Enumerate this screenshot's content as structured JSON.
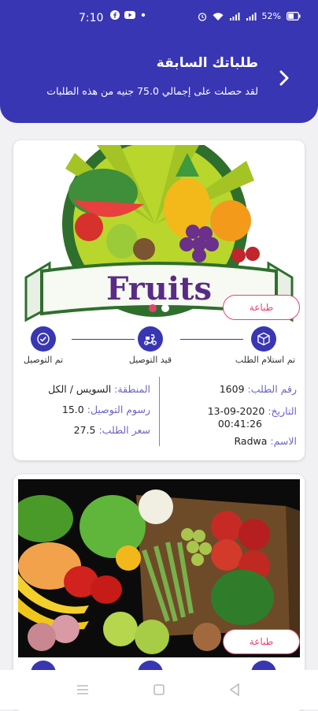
{
  "status_bar": {
    "time": "7:10",
    "battery": "52%",
    "icons_left": [
      "facebook-icon",
      "youtube-icon",
      "dot-icon"
    ],
    "icons_right": [
      "alarm-icon",
      "wifi-icon",
      "signal-icon",
      "battery-icon"
    ]
  },
  "header": {
    "title": "طلباتك السابقة",
    "subtitle": "لقد حصلت على إجمالي 75.0 جنيه من هذه الطلبات",
    "back_icon": "chevron-right-icon"
  },
  "orders": [
    {
      "image_text": "Fruits",
      "print_label": "طباعة",
      "steps": [
        {
          "label": "تم استلام الطلب",
          "icon": "box-icon"
        },
        {
          "label": "قيد التوصيل",
          "icon": "delivery-scooter-icon"
        },
        {
          "label": "تم التوصيل",
          "icon": "check-icon"
        }
      ],
      "order_number_label": "رقم الطلب:",
      "order_number": "1609",
      "date_label": "التاريخ:",
      "date": "2020-09-13",
      "time": "00:41:26",
      "name_label": "الاسم:",
      "name": "Radwa",
      "region_label": "المنطقة:",
      "region": "السويس / الكل",
      "delivery_fee_label": "رسوم التوصيل:",
      "delivery_fee": "15.0",
      "order_price_label": "سعر الطلب:",
      "order_price": "27.5",
      "carousel_dots": 2,
      "carousel_active": 0
    },
    {
      "image_text": "",
      "print_label": "طباعة"
    }
  ],
  "colors": {
    "primary": "#3936b3",
    "accent": "#e2456f"
  }
}
